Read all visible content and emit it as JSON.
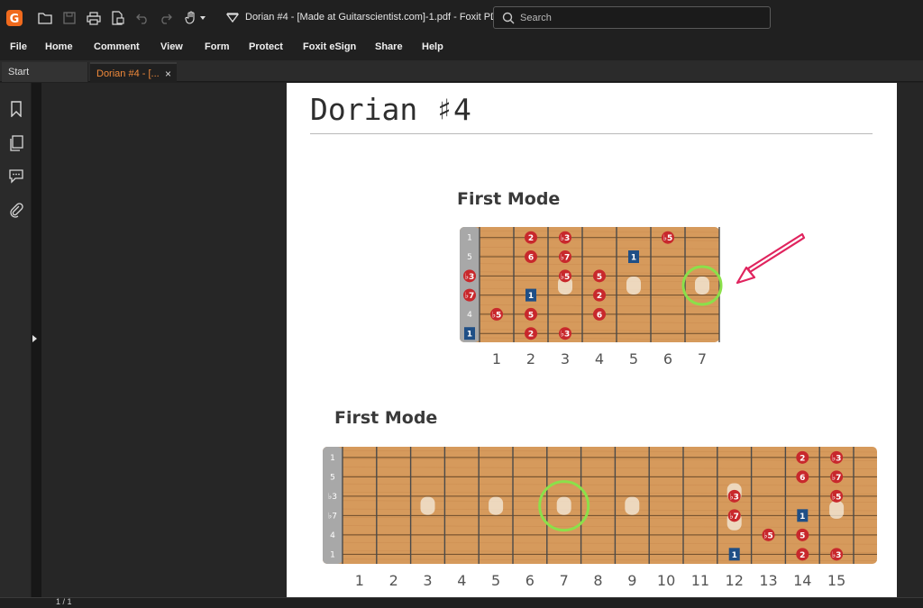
{
  "app": {
    "document_title": "Dorian #4 - [Made at Guitarscientist.com]-1.pdf - Foxit PD...",
    "search_placeholder": "Search"
  },
  "menu": [
    "File",
    "Home",
    "Comment",
    "View",
    "Form",
    "Protect",
    "Foxit eSign",
    "Share",
    "Help"
  ],
  "tabs": {
    "start": "Start",
    "active": "Dorian #4 - [...",
    "close": "×"
  },
  "status": {
    "page_indicator": "1 / 1"
  },
  "page": {
    "title": "Dorian ♯4",
    "section1_title": "First Mode",
    "section2_title": "First Mode"
  },
  "colors": {
    "note_red": "#c8282c",
    "root_blue": "#1f4f86",
    "highlight_green": "#8be04a",
    "arrow_pink": "#e0245e",
    "wood": "#d69a5c"
  },
  "diagram1": {
    "strings": [
      "1",
      "5",
      "♭3",
      "♭7",
      "4",
      "1"
    ],
    "fret_numbers": [
      "1",
      "2",
      "3",
      "4",
      "5",
      "6",
      "7"
    ],
    "notes": [
      {
        "s": 0,
        "f": 2,
        "label": "2",
        "kind": "note"
      },
      {
        "s": 0,
        "f": 3,
        "label": "♭3",
        "kind": "note"
      },
      {
        "s": 0,
        "f": 6,
        "label": "♭5",
        "kind": "note"
      },
      {
        "s": 1,
        "f": 2,
        "label": "6",
        "kind": "note"
      },
      {
        "s": 1,
        "f": 3,
        "label": "♭7",
        "kind": "note"
      },
      {
        "s": 1,
        "f": 5,
        "label": "1",
        "kind": "root"
      },
      {
        "s": 2,
        "f": 0,
        "label": "♭3",
        "kind": "note"
      },
      {
        "s": 2,
        "f": 3,
        "label": "♭5",
        "kind": "note"
      },
      {
        "s": 2,
        "f": 4,
        "label": "5",
        "kind": "note"
      },
      {
        "s": 3,
        "f": 0,
        "label": "♭7",
        "kind": "note"
      },
      {
        "s": 3,
        "f": 2,
        "label": "1",
        "kind": "root"
      },
      {
        "s": 3,
        "f": 4,
        "label": "2",
        "kind": "note"
      },
      {
        "s": 4,
        "f": 1,
        "label": "♭5",
        "kind": "note"
      },
      {
        "s": 4,
        "f": 2,
        "label": "5",
        "kind": "note"
      },
      {
        "s": 4,
        "f": 4,
        "label": "6",
        "kind": "note"
      },
      {
        "s": 5,
        "f": 0,
        "label": "1",
        "kind": "root"
      },
      {
        "s": 5,
        "f": 2,
        "label": "2",
        "kind": "note"
      },
      {
        "s": 5,
        "f": 3,
        "label": "♭3",
        "kind": "note"
      }
    ],
    "highlight_fret": 7
  },
  "diagram2": {
    "strings": [
      "1",
      "5",
      "♭3",
      "♭7",
      "4",
      "1"
    ],
    "fret_numbers": [
      "1",
      "2",
      "3",
      "4",
      "5",
      "6",
      "7",
      "8",
      "9",
      "10",
      "11",
      "12",
      "13",
      "14",
      "15"
    ],
    "notes": [
      {
        "s": 0,
        "f": 14,
        "label": "2",
        "kind": "note"
      },
      {
        "s": 0,
        "f": 15,
        "label": "♭3",
        "kind": "note"
      },
      {
        "s": 1,
        "f": 14,
        "label": "6",
        "kind": "note"
      },
      {
        "s": 1,
        "f": 15,
        "label": "♭7",
        "kind": "note"
      },
      {
        "s": 2,
        "f": 12,
        "label": "♭3",
        "kind": "note"
      },
      {
        "s": 2,
        "f": 15,
        "label": "♭5",
        "kind": "note"
      },
      {
        "s": 3,
        "f": 12,
        "label": "♭7",
        "kind": "note"
      },
      {
        "s": 3,
        "f": 14,
        "label": "1",
        "kind": "root"
      },
      {
        "s": 4,
        "f": 13,
        "label": "♭5",
        "kind": "note"
      },
      {
        "s": 4,
        "f": 14,
        "label": "5",
        "kind": "note"
      },
      {
        "s": 5,
        "f": 12,
        "label": "1",
        "kind": "root"
      },
      {
        "s": 5,
        "f": 14,
        "label": "2",
        "kind": "note"
      },
      {
        "s": 5,
        "f": 15,
        "label": "♭3",
        "kind": "note"
      }
    ],
    "highlight_fret": 7
  }
}
